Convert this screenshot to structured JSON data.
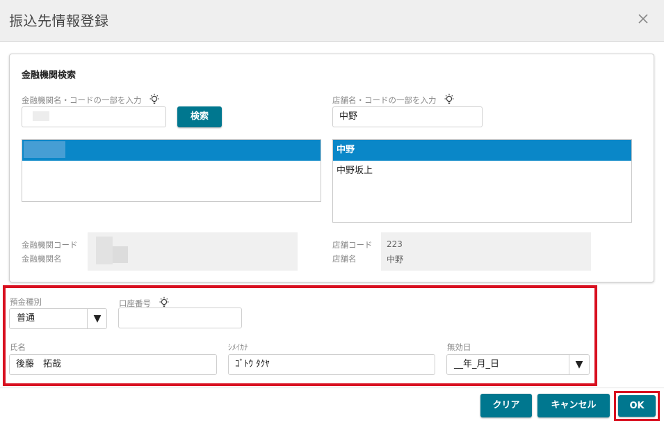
{
  "dialog": {
    "title": "振込先情報登録",
    "close_icon": "close-icon"
  },
  "bank_search": {
    "section_title": "金融機関検索",
    "bank_query_label": "金融機関名・コードの一部を入力",
    "bank_query_value": "",
    "search_button": "検索",
    "branch_query_label": "店舗名・コードの一部を入力",
    "branch_query_value": "中野",
    "bank_results": [
      ""
    ],
    "branch_results": [
      "中野",
      "中野坂上"
    ],
    "bank_code_label": "金融機関コード",
    "bank_name_label": "金融機関名",
    "bank_code_value": "",
    "bank_name_value": "",
    "branch_code_label": "店舗コード",
    "branch_name_label": "店舗名",
    "branch_code_value": "223",
    "branch_name_value": "中野"
  },
  "account": {
    "deposit_type_label": "預金種別",
    "deposit_type_value": "普通",
    "account_number_label": "口座番号",
    "account_number_value": "",
    "name_label": "氏名",
    "name_value": "後藤　拓哉",
    "kana_label": "ｼﾒｲｶﾅ",
    "kana_value": "ｺﾞﾄｳ ﾀｸﾔ",
    "expiry_label": "無効日",
    "expiry_value": "__年_月_日"
  },
  "footer": {
    "clear_button": "クリア",
    "cancel_button": "キャンセル",
    "ok_button": "OK"
  },
  "colors": {
    "accent": "#00778f",
    "selection": "#0a87c8",
    "highlight": "#d81020"
  }
}
